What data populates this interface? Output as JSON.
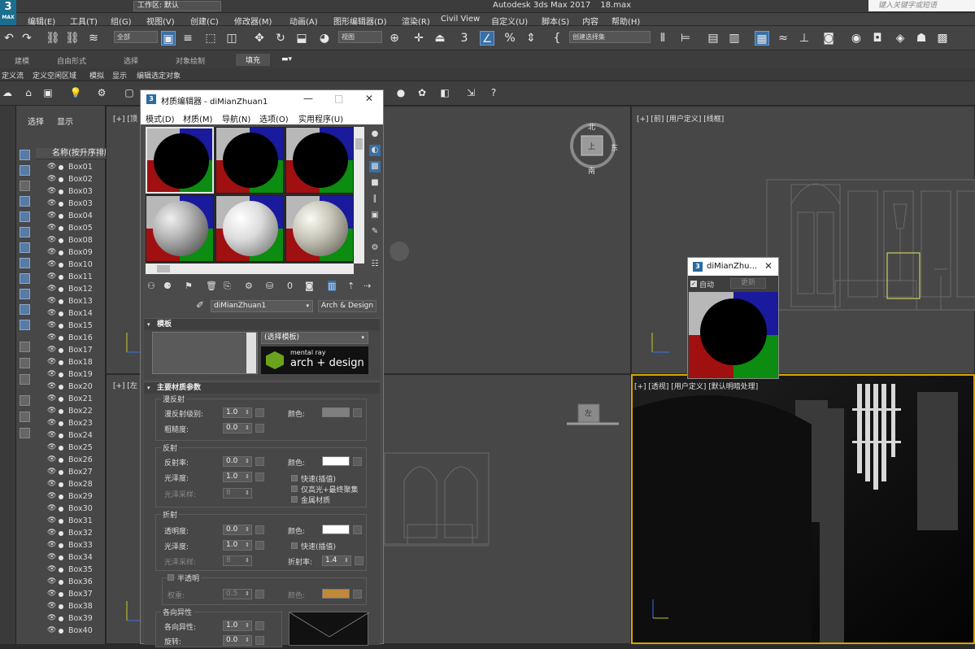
{
  "app": {
    "title": "Autodesk 3ds Max 2017",
    "file": "18.max",
    "logo": "3",
    "logo_sub": "MAX",
    "workspace": "工作区: 默认",
    "search_placeholder": "键入关键字或短语"
  },
  "menu": [
    "编辑(E)",
    "工具(T)",
    "组(G)",
    "视图(V)",
    "创建(C)",
    "修改器(M)",
    "动画(A)",
    "图形编辑器(D)",
    "渲染(R)",
    "Civil View",
    "自定义(U)",
    "脚本(S)",
    "内容",
    "帮助(H)"
  ],
  "toolbar": {
    "filter": "全部",
    "view": "视图",
    "selection_set": "创建选择集"
  },
  "ribbon": {
    "tabs": [
      "建模",
      "自由形式",
      "选择",
      "对象绘制",
      "填充"
    ],
    "active": "填充",
    "sub": [
      "定义流",
      "定义空闲区域",
      "模拟",
      "显示",
      "编辑选定对象"
    ]
  },
  "scene_explorer": {
    "tabs": [
      "选择",
      "显示"
    ],
    "column_header": "名称(按升序排序)",
    "items": [
      "Box01",
      "Box02",
      "Box03",
      "Box03",
      "Box04",
      "Box05",
      "Box08",
      "Box09",
      "Box10",
      "Box11",
      "Box12",
      "Box13",
      "Box14",
      "Box15",
      "Box16",
      "Box17",
      "Box18",
      "Box19",
      "Box20",
      "Box21",
      "Box22",
      "Box23",
      "Box24",
      "Box25",
      "Box26",
      "Box27",
      "Box28",
      "Box29",
      "Box30",
      "Box31",
      "Box32",
      "Box33",
      "Box34",
      "Box35",
      "Box36",
      "Box37",
      "Box38",
      "Box39",
      "Box40"
    ]
  },
  "viewports": {
    "top_left": "[+] [顶",
    "top_right": "[+] [前] [用户定义] [线框]",
    "bottom_left": "[+] [左",
    "bottom_right": "[+] [透视] [用户定义] [默认明暗处理]",
    "viewcube_top": "上",
    "viewcube_bottom": "左",
    "compass": {
      "n": "北",
      "e": "东",
      "s": "南"
    }
  },
  "material_editor": {
    "title": "材质编辑器 - diMianZhuan1",
    "menu": [
      "模式(D)",
      "材质(M)",
      "导航(N)",
      "选项(O)",
      "实用程序(U)"
    ],
    "material_name": "diMianZhuan1",
    "material_type": "Arch & Design",
    "rollout_template": "模板",
    "template_select": "(选择模板)",
    "brand_top": "mental ray",
    "brand_main": "arch + design",
    "rollout_main": "主要材质参数",
    "diffuse": {
      "group": "漫反射",
      "level_label": "漫反射级别:",
      "level": "1.0",
      "rough_label": "粗糙度:",
      "rough": "0.0",
      "color_label": "颜色:",
      "color": "#7f7f7f"
    },
    "reflection": {
      "group": "反射",
      "refl_label": "反射率:",
      "refl": "0.0",
      "gloss_label": "光泽度:",
      "gloss": "1.0",
      "samples_label": "光泽采样:",
      "samples": "8",
      "color_label": "颜色:",
      "color": "#ffffff",
      "opt1": "快速(插值)",
      "opt2": "仅高光+最终聚集",
      "opt3": "金属材质"
    },
    "refraction": {
      "group": "折射",
      "trans_label": "透明度:",
      "trans": "0.0",
      "gloss_label": "光泽度:",
      "gloss": "1.0",
      "samples_label": "光泽采样:",
      "samples": "8",
      "color_label": "颜色:",
      "color": "#ffffff",
      "opt1": "快速(插值)",
      "ior_label": "折射率:",
      "ior": "1.4"
    },
    "translucency": {
      "group": "半透明",
      "weight_label": "权重:",
      "weight": "0.5",
      "color_label": "颜色:",
      "color": "#c08a3a"
    },
    "anisotropy": {
      "group": "各向异性",
      "aniso_label": "各向异性:",
      "aniso": "1.0",
      "rotation_label": "旋转:",
      "rotation": "0.0"
    }
  },
  "sub_window": {
    "title": "diMianZhu...",
    "auto_label": "自动",
    "update_label": "更新"
  }
}
